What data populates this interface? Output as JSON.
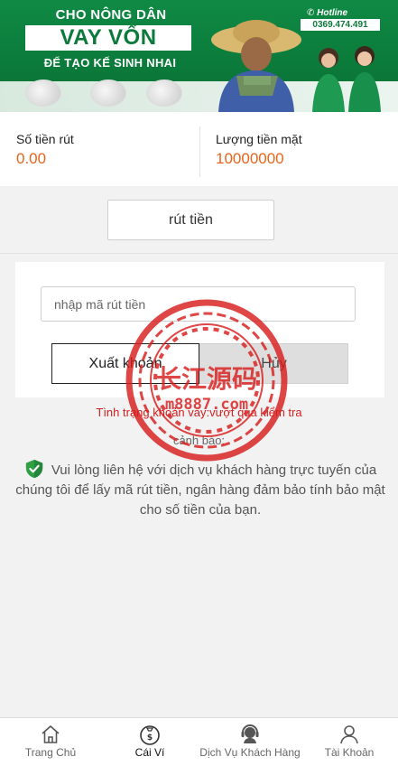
{
  "banner": {
    "line1": "CHO NÔNG DÂN",
    "line2": "VAY VỐN",
    "line3": "ĐỂ TẠO KẾ SINH NHAI",
    "hotline_label": "Hotline",
    "hotline_number": "0369.474.491"
  },
  "stats": {
    "withdrawn_label": "Số tiền rút",
    "withdrawn_value": "0.00",
    "cash_label": "Lượng tiền mặt",
    "cash_value": "10000000"
  },
  "withdraw_button": "rút tiền",
  "form": {
    "code_placeholder": "nhập mã rút tiền",
    "code_value": "",
    "export_button": "Xuất khoản",
    "cancel_button": "Hủy"
  },
  "status_text": "Tình trạng khoản vay:vượt qua kiểm tra",
  "warning_label": "cảnh báo:",
  "notice_text": "Vui lòng liên hệ với dịch vụ khách hàng trực tuyến của chúng tôi để lấy mã rút tiền, ngân hàng đảm bảo tính bảo mật cho số tiền của bạn.",
  "watermark": {
    "line1": "长江源码",
    "line2": "m8887.com"
  },
  "tabbar": {
    "active": "Cái Ví",
    "items": [
      {
        "label": "Trang Chủ",
        "icon": "home-icon"
      },
      {
        "label": "Cái Ví",
        "icon": "wallet-icon"
      },
      {
        "label": "Dịch Vụ Khách Hàng",
        "icon": "customer-service-icon"
      },
      {
        "label": "Tài Khoản",
        "icon": "user-icon"
      }
    ]
  },
  "colors": {
    "banner_green": "#0b7a3a",
    "accent_orange": "#e8641a",
    "status_red": "#d21f1f",
    "shield_green": "#2ea043"
  }
}
